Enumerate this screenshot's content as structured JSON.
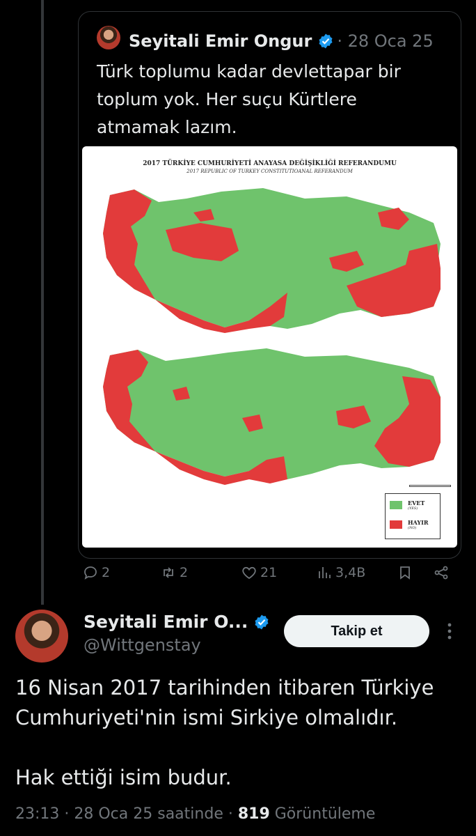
{
  "colors": {
    "background": "#000000",
    "accent": "#1d9bf0",
    "evet": "#6fc36c",
    "hayir": "#e23b3b"
  },
  "quoted_tweet": {
    "author_name": "Seyitali Emir Ongur",
    "verified": true,
    "meta": "· 28 Oca 25",
    "text": "Türk toplumu kadar devlettapar bir toplum yok. Her suçu Kürtlere atmamak lazım.",
    "image": {
      "title": "2017 TÜRKİYE CUMHURİYETİ ANAYASA DEĞİŞİKLİĞİ REFERANDUMU",
      "subtitle": "2017 REPUBLIC OF TURKEY CONSTITUTIOANAL REFERANDUM",
      "legend": [
        {
          "label": "EVET",
          "sub": "(YES)",
          "color": "#6fc36c"
        },
        {
          "label": "HAYIR",
          "sub": "(NO)",
          "color": "#e23b3b"
        }
      ]
    },
    "actions": {
      "reply": {
        "icon": "reply-icon",
        "count": "2"
      },
      "retweet": {
        "icon": "retweet-icon",
        "count": "2"
      },
      "like": {
        "icon": "heart-icon",
        "count": "21"
      },
      "views": {
        "icon": "views-icon",
        "count": "3,4B"
      },
      "bookmark": {
        "icon": "bookmark-icon"
      },
      "share": {
        "icon": "share-icon"
      }
    }
  },
  "main_tweet": {
    "author_name": "Seyitali Emir O...",
    "verified": true,
    "handle": "@Wittgenstay",
    "follow_label": "Takip et",
    "paragraphs": [
      "16 Nisan 2017 tarihinden itibaren Türkiye Cumhuriyeti'nin ismi Sirkiye olmalıdır.",
      "Hak ettiği isim budur."
    ],
    "time": "23:13 · 28 Oca 25 saatinde · ",
    "views": "819",
    "views_label": " Görüntüleme"
  }
}
